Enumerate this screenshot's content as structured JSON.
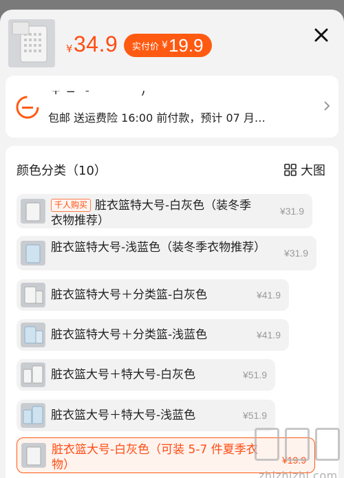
{
  "header": {
    "price_symbol": "¥",
    "price": "34.9",
    "final_label": "实付价",
    "final_symbol": "¥",
    "final_price": "19.9",
    "close_icon": "close-icon"
  },
  "address": {
    "line1_partial": "+ =  ̄   -   ̄  ̄   ̄ ̄ ̄  ̄  ̄  ̄ ‘”)",
    "line2": "包邮  送运费险  16:00 前付款，预计 07 月…",
    "icon": "location-icon"
  },
  "options_panel": {
    "title": "颜色分类（10）",
    "big_view_label": "大图",
    "items": [
      {
        "tag": "千人购买",
        "name": "脏衣篮特大号-白灰色（装冬季衣物推荐）",
        "price": "¥31.9"
      },
      {
        "tag": "",
        "name": "脏衣篮特大号-浅蓝色（装冬季衣物推荐）",
        "price": "¥31.9"
      },
      {
        "tag": "",
        "name": "脏衣篮特大号＋分类篮-白灰色",
        "price": "¥41.9"
      },
      {
        "tag": "",
        "name": "脏衣篮特大号＋分类篮-浅蓝色",
        "price": "¥41.9"
      },
      {
        "tag": "",
        "name": "脏衣篮大号＋特大号-白灰色",
        "price": "¥51.9"
      },
      {
        "tag": "",
        "name": "脏衣篮大号＋特大号-浅蓝色",
        "price": "¥51.9"
      },
      {
        "tag": "",
        "name": "脏衣篮大号-白灰色（可装 5-7 件夏季衣物）",
        "price": "¥19.9"
      }
    ]
  },
  "watermark": {
    "text": "zhizhizhi.com"
  },
  "colors": {
    "accent": "#ff5a12",
    "price": "#ff4d13",
    "panel_bg": "#ffffff",
    "item_bg": "#f2f2f2"
  }
}
